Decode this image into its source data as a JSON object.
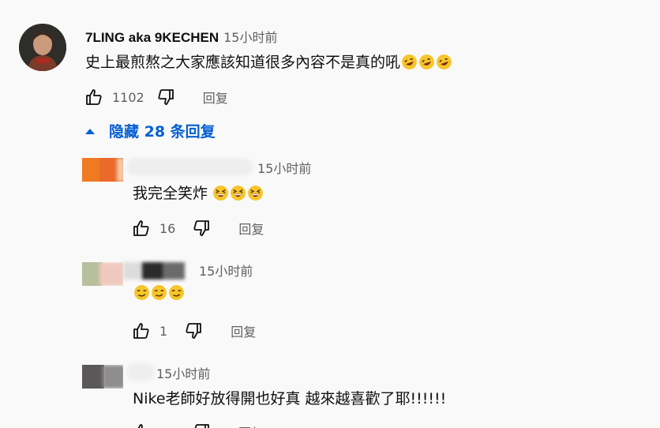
{
  "comment": {
    "author": "7LING aka 9KECHEN",
    "time": "15小时前",
    "text": "史上最煎熬之大家應該知道很多內容不是真的吼",
    "emoji_icons": [
      "rofl-emoji-icon",
      "rofl-emoji-icon",
      "rofl-emoji-icon"
    ],
    "likes": "1102",
    "reply_label": "回复"
  },
  "replies_toggle": {
    "label": "隐藏 28 条回复",
    "color": "#065fd4"
  },
  "replies": [
    {
      "time": "15小时前",
      "text": "我完全笑炸",
      "emoji_icons": [
        "grinning-squint-emoji-icon",
        "grinning-squint-emoji-icon",
        "grinning-squint-emoji-icon"
      ],
      "likes": "16",
      "reply_label": "回复"
    },
    {
      "time": "15小时前",
      "text": "",
      "emoji_icons": [
        "smirk-emoji-icon",
        "smirk-emoji-icon",
        "smirk-emoji-icon"
      ],
      "likes": "1",
      "reply_label": "回复"
    },
    {
      "time": "15小时前",
      "text": "Nike老師好放得開也好真 越來越喜歡了耶!!!!!!",
      "emoji_icons": [],
      "likes": "",
      "reply_label": "回复"
    }
  ],
  "colors": {
    "background": "#f9f9f9",
    "text_primary": "#0f0f0f",
    "text_secondary": "#606060",
    "link_blue": "#065fd4"
  }
}
